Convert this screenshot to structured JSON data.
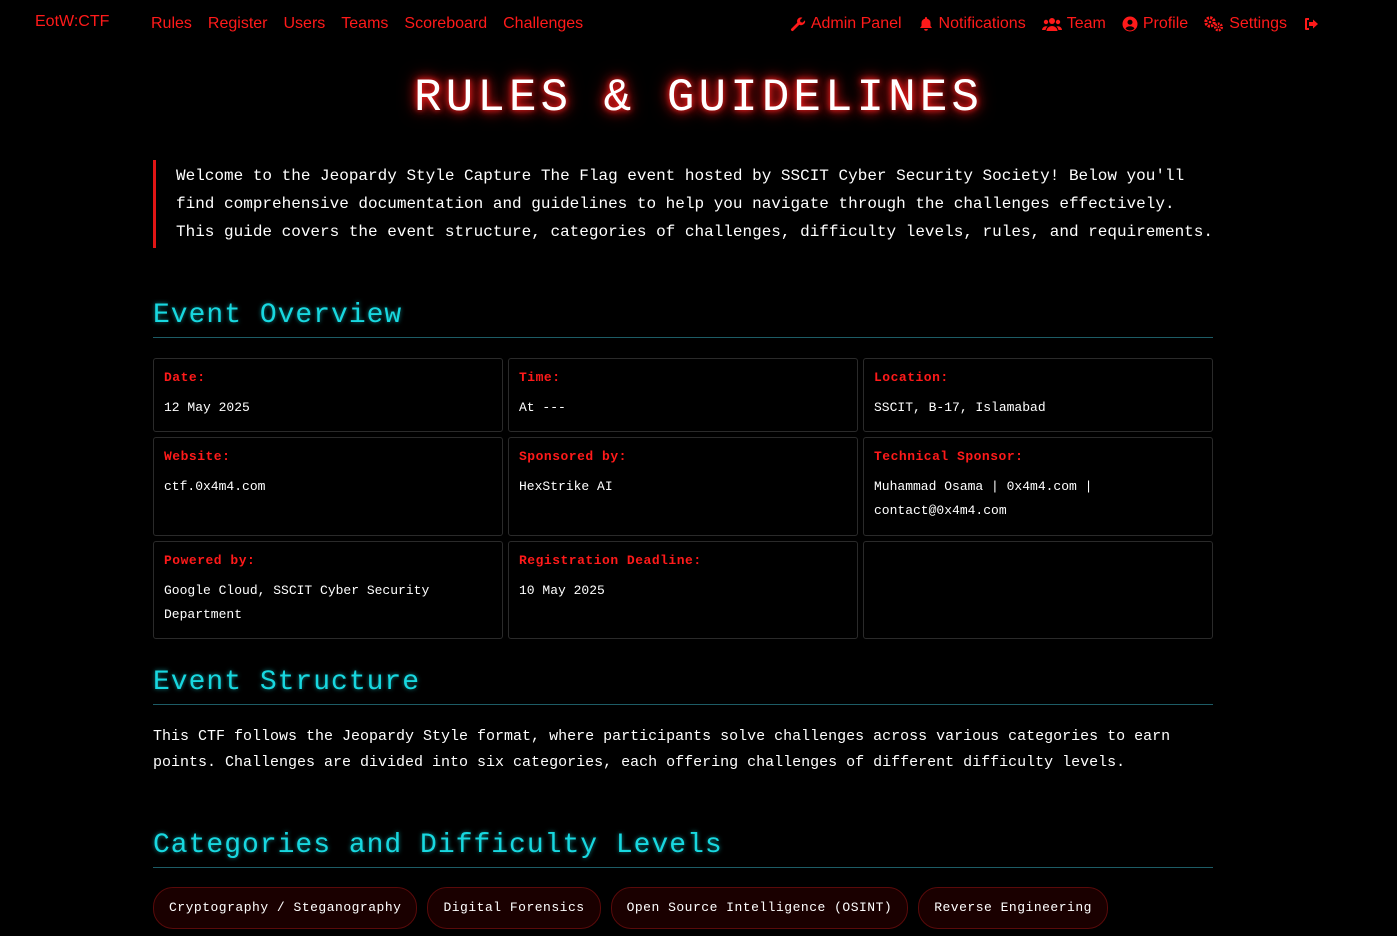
{
  "nav": {
    "brand": "EotW:CTF",
    "left_links": [
      "Rules",
      "Register",
      "Users",
      "Teams",
      "Scoreboard",
      "Challenges"
    ],
    "right_links": [
      {
        "label": "Admin Panel",
        "icon": "wrench-icon"
      },
      {
        "label": "Notifications",
        "icon": "bell-icon"
      },
      {
        "label": "Team",
        "icon": "users-icon"
      },
      {
        "label": "Profile",
        "icon": "user-circle-icon"
      },
      {
        "label": "Settings",
        "icon": "gears-icon"
      }
    ],
    "logout_icon": "sign-out-icon",
    "accent_color": "#ff1a1a"
  },
  "page_title": "RULES & GUIDELINES",
  "intro": "Welcome to the Jeopardy Style Capture The Flag event hosted by SSCIT Cyber Security Society! Below you'll find comprehensive documentation and guidelines to help you navigate through the challenges effectively. This guide covers the event structure, categories of challenges, difficulty levels, rules, and requirements.",
  "overview": {
    "title": "Event Overview",
    "items": [
      {
        "label": "Date:",
        "value": "12 May 2025"
      },
      {
        "label": "Time:",
        "value": "At ---"
      },
      {
        "label": "Location:",
        "value": "SSCIT, B-17, Islamabad"
      },
      {
        "label": "Website:",
        "value": "ctf.0x4m4.com"
      },
      {
        "label": "Sponsored by:",
        "value": "HexStrike AI"
      },
      {
        "label": "Technical Sponsor:",
        "value": "Muhammad Osama | 0x4m4.com | contact@0x4m4.com"
      },
      {
        "label": "Powered by:",
        "value": "Google Cloud, SSCIT Cyber Security Department"
      },
      {
        "label": "Registration Deadline:",
        "value": "10 May 2025"
      },
      {
        "label": "",
        "value": ""
      }
    ]
  },
  "structure": {
    "title": "Event Structure",
    "text": "This CTF follows the Jeopardy Style format, where participants solve challenges across various categories to earn points. Challenges are divided into six categories, each offering challenges of different difficulty levels."
  },
  "categories": {
    "title": "Categories and Difficulty Levels",
    "items": [
      "Cryptography / Steganography",
      "Digital Forensics",
      "Open Source Intelligence (OSINT)",
      "Reverse Engineering"
    ]
  },
  "colors": {
    "accent_red": "#ff1a1a",
    "heading_cyan": "#18d8e0",
    "background": "#000000"
  }
}
